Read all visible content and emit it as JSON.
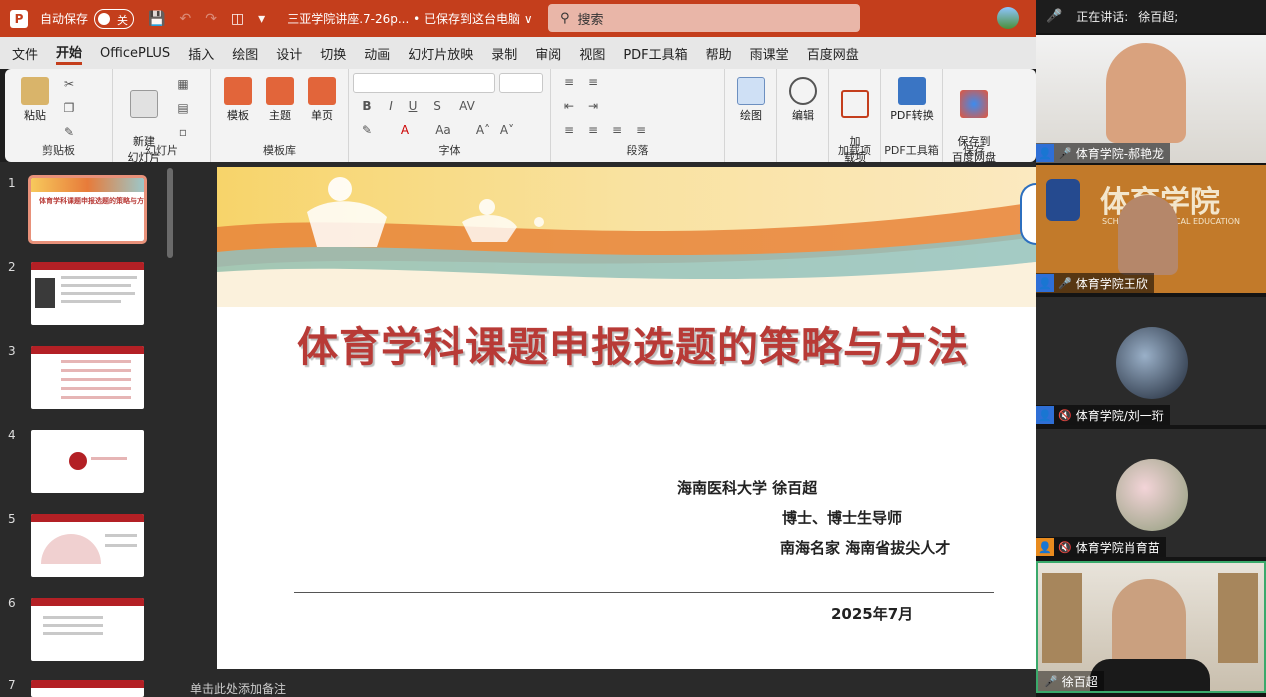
{
  "titlebar": {
    "app": "P",
    "autosave_label": "自动保存",
    "toggle_state": "关",
    "doc_title": "三亚学院讲座.7-26p...  • 已保存到这台电脑 ∨",
    "search_placeholder": "搜索"
  },
  "tabs": [
    "文件",
    "开始",
    "OfficePLUS",
    "插入",
    "绘图",
    "设计",
    "切换",
    "动画",
    "幻灯片放映",
    "录制",
    "审阅",
    "视图",
    "PDF工具箱",
    "帮助",
    "雨课堂",
    "百度网盘"
  ],
  "ribbon": {
    "clipboard": {
      "label": "剪贴板",
      "paste": "粘贴"
    },
    "slides": {
      "label": "幻灯片",
      "new_slide": "新建\n幻灯片"
    },
    "templates": {
      "label": "模板库",
      "template": "模板",
      "theme": "主题",
      "single": "单页"
    },
    "font": {
      "label": "字体",
      "bold": "B",
      "italic": "I",
      "underline": "U",
      "strike": "S",
      "spacing": "AV",
      "case": "Aa",
      "grow": "A˄",
      "shrink": "A˅"
    },
    "paragraph": {
      "label": "段落"
    },
    "drawing": {
      "label": "绘图"
    },
    "editing": {
      "label": "编辑"
    },
    "addins": {
      "label": "加载项",
      "button": "加\n载项"
    },
    "pdf": {
      "label": "PDF工具箱",
      "button": "PDF转换"
    },
    "save": {
      "label": "保存",
      "button": "保存到\n百度网盘"
    }
  },
  "thumbnails": {
    "numbers": [
      "1",
      "2",
      "3",
      "4",
      "5",
      "6",
      "7"
    ],
    "slide1_title": "体育学科课题申报选题的策略与方法"
  },
  "slide": {
    "title": "体育学科课题申报选题的策略与方法",
    "author_line": "海南医科大学  徐百超",
    "degree_line": "博士、博士生导师",
    "honor_line": "南海名家    海南省拔尖人才",
    "date": "2025年7月"
  },
  "notes_placeholder": "单击此处添加备注",
  "meeting": {
    "speaking_label": "正在讲话:",
    "speaker": "徐百超;",
    "participants": [
      {
        "name": "体育学院-郝艳龙"
      },
      {
        "name": "体育学院王欣"
      },
      {
        "name": "体育学院/刘一珩"
      },
      {
        "name": "体育学院肖育苗"
      },
      {
        "name": "徐百超"
      }
    ],
    "wall_text_1": "体育学院",
    "wall_text_2": "SCHOOL OF PHYSICAL EDUCATION"
  }
}
